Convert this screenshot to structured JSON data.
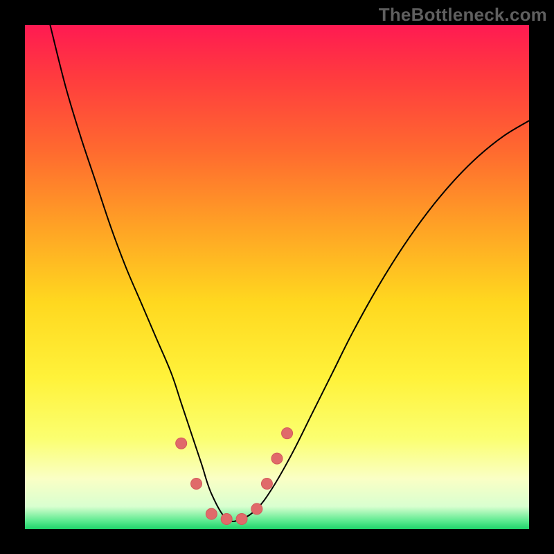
{
  "watermark": "TheBottleneck.com",
  "chart_data": {
    "type": "line",
    "title": "",
    "xlabel": "",
    "ylabel": "",
    "xlim": [
      0,
      100
    ],
    "ylim": [
      0,
      100
    ],
    "grid": false,
    "legend": false,
    "gradient_stops": [
      {
        "offset": 0.0,
        "color": "#ff1a52"
      },
      {
        "offset": 0.1,
        "color": "#ff3a3f"
      },
      {
        "offset": 0.25,
        "color": "#ff6a2f"
      },
      {
        "offset": 0.4,
        "color": "#ffa225"
      },
      {
        "offset": 0.55,
        "color": "#ffd81f"
      },
      {
        "offset": 0.7,
        "color": "#fff23a"
      },
      {
        "offset": 0.82,
        "color": "#fbff70"
      },
      {
        "offset": 0.9,
        "color": "#faffc5"
      },
      {
        "offset": 0.955,
        "color": "#d9ffd0"
      },
      {
        "offset": 0.985,
        "color": "#57e98d"
      },
      {
        "offset": 1.0,
        "color": "#1fd36a"
      }
    ],
    "series": [
      {
        "name": "curve",
        "stroke": "#000000",
        "stroke_width": 2,
        "x": [
          5,
          8,
          11,
          14,
          17,
          20,
          23,
          26,
          29,
          31,
          33,
          35,
          37,
          40,
          43,
          46,
          49,
          53,
          57,
          61,
          65,
          70,
          75,
          80,
          85,
          90,
          95,
          100
        ],
        "y": [
          100,
          88,
          78,
          69,
          60,
          52,
          45,
          38,
          31,
          25,
          19,
          13,
          7,
          2,
          2,
          4,
          8,
          15,
          23,
          31,
          39,
          48,
          56,
          63,
          69,
          74,
          78,
          81
        ]
      }
    ],
    "markers": {
      "name": "pink-dots",
      "fill": "#e06a6a",
      "stroke": "#d45a5a",
      "radius_px": 8,
      "points": [
        {
          "x": 31,
          "y": 17
        },
        {
          "x": 34,
          "y": 9
        },
        {
          "x": 37,
          "y": 3
        },
        {
          "x": 40,
          "y": 2
        },
        {
          "x": 43,
          "y": 2
        },
        {
          "x": 46,
          "y": 4
        },
        {
          "x": 48,
          "y": 9
        },
        {
          "x": 50,
          "y": 14
        },
        {
          "x": 52,
          "y": 19
        }
      ]
    }
  }
}
